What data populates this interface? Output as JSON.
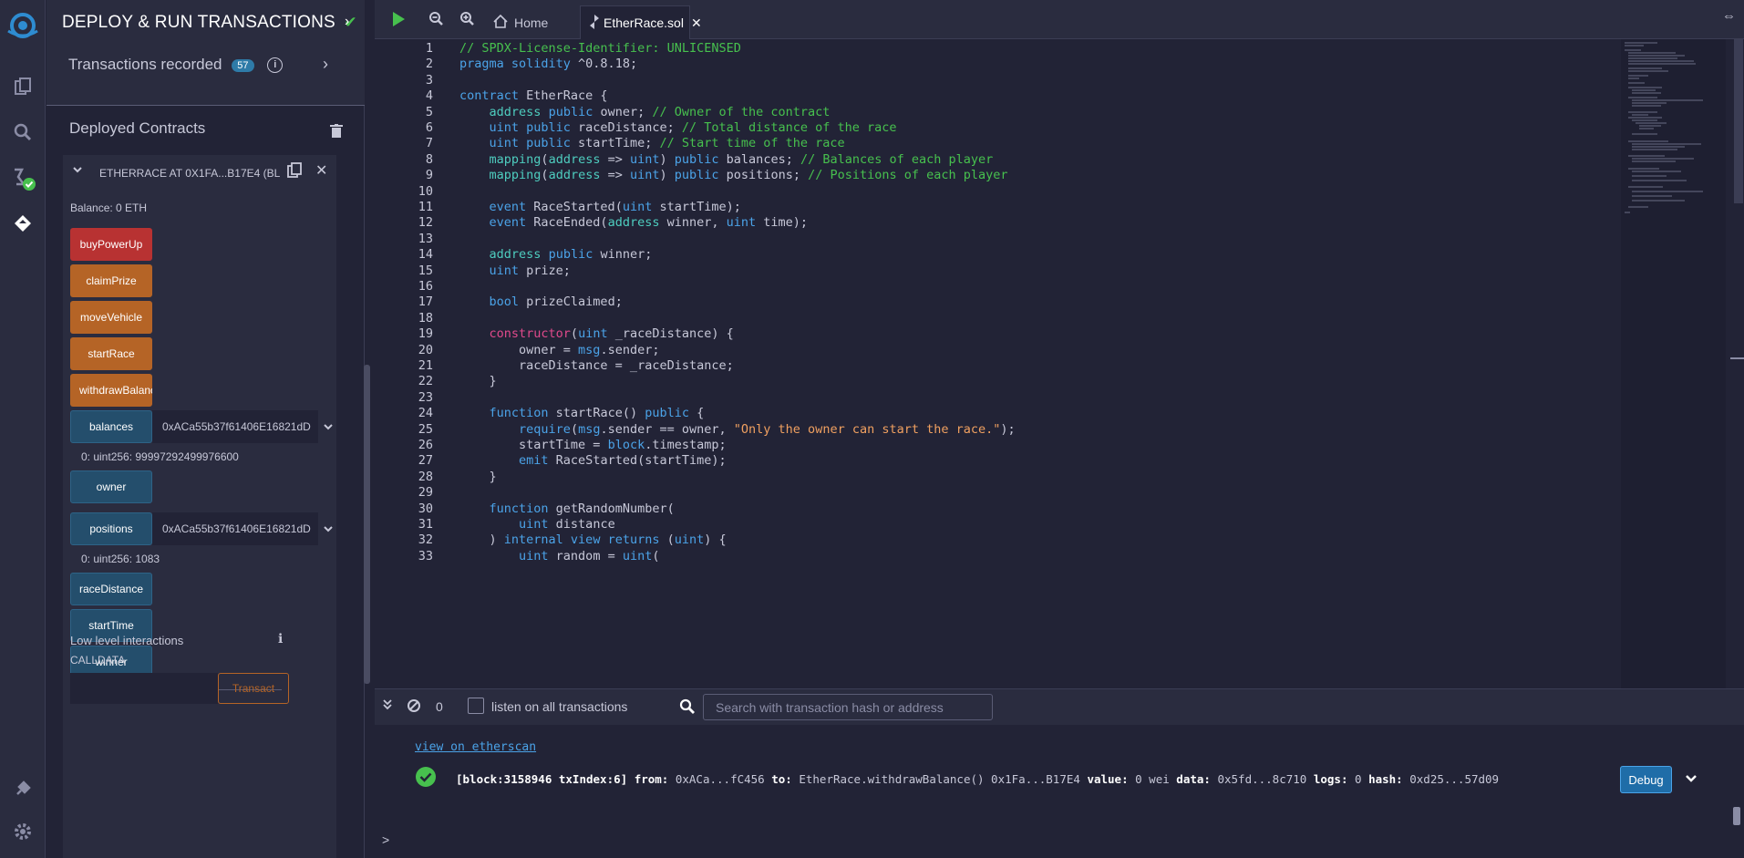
{
  "side_panel": {
    "title": "DEPLOY & RUN TRANSACTIONS",
    "transactions_label": "Transactions recorded",
    "transactions_count": "57",
    "info_glyph": "i",
    "deployed_title": "Deployed Contracts",
    "instance": {
      "title": "ETHERRACE AT 0X1FA...B17E4 (BL",
      "balance": "Balance: 0 ETH",
      "buttons": [
        {
          "label": "buyPowerUp",
          "color": "#b83232"
        },
        {
          "label": "claimPrize",
          "color": "#b56426"
        },
        {
          "label": "moveVehicle",
          "color": "#b56426"
        },
        {
          "label": "startRace",
          "color": "#b56426"
        },
        {
          "label": "withdrawBalance",
          "color": "#b56426"
        }
      ],
      "calls": {
        "balances": {
          "label": "balances",
          "input": "0xACa55b37f61406E16821dD",
          "result": "0: uint256: 99997292499976600"
        },
        "owner": {
          "label": "owner"
        },
        "positions": {
          "label": "positions",
          "input": "0xACa55b37f61406E16821dD",
          "result": "0: uint256: 1083"
        },
        "raceDistance": {
          "label": "raceDistance"
        },
        "startTime": {
          "label": "startTime"
        },
        "winner": {
          "label": "winner"
        }
      },
      "low_level": "Low level interactions",
      "calldata": "CALLDATA",
      "transact": "Transact"
    }
  },
  "tabs": {
    "home": "Home",
    "file": "EtherRace.sol"
  },
  "editor": {
    "line_numbers": [
      "1",
      "2",
      "3",
      "4",
      "5",
      "6",
      "7",
      "8",
      "9",
      "10",
      "11",
      "12",
      "13",
      "14",
      "15",
      "16",
      "17",
      "18",
      "19",
      "20",
      "21",
      "22",
      "23",
      "24",
      "25",
      "26",
      "27",
      "28",
      "29",
      "30",
      "31",
      "32",
      "33"
    ]
  },
  "terminal": {
    "count": "0",
    "listen_label": "listen on all transactions",
    "search_placeholder": "Search with transaction hash or address",
    "etherscan_link": "view on etherscan",
    "tx": {
      "block": "[block:3158946 txIndex:6]",
      "from_label": "from:",
      "from": "0xACa...fC456",
      "to_label": "to:",
      "to": "EtherRace.withdrawBalance() 0x1Fa...B17E4",
      "value_label": "value:",
      "value": "0 wei",
      "data_label": "data:",
      "data": "0x5fd...8c710",
      "logs_label": "logs:",
      "logs": "0",
      "hash_label": "hash:",
      "hash": "0xd25...57d09"
    },
    "debug": "Debug",
    "prompt": ">"
  },
  "colors": {
    "accent_green": "#47c04e",
    "button_red": "#b83232",
    "button_orange": "#b56426",
    "button_blue": "#244e6c"
  }
}
